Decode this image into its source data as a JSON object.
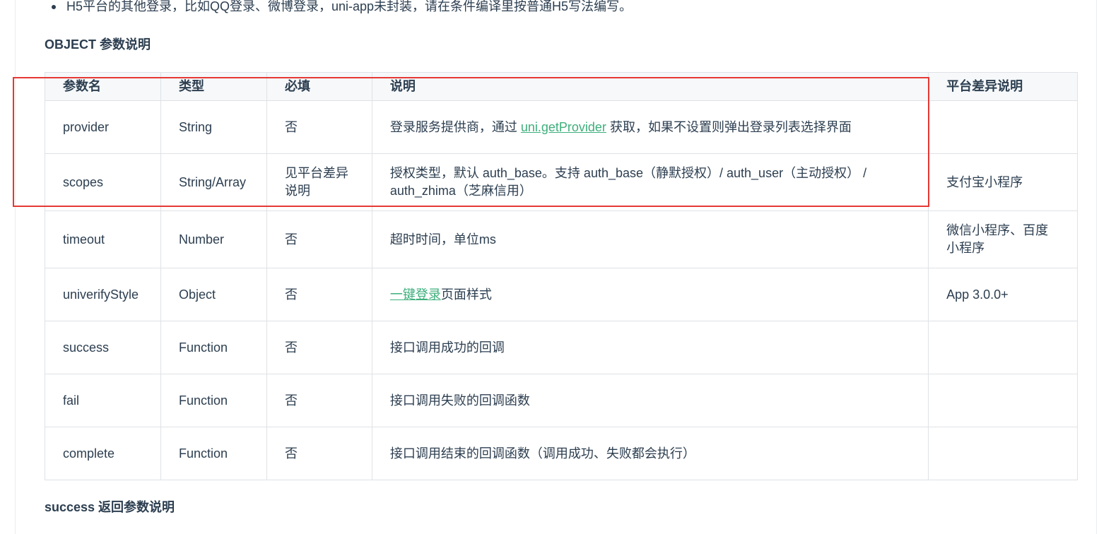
{
  "intro_bullet": "H5平台的其他登录，比如QQ登录、微博登录，uni-app未封装，请在条件编译里按普通H5写法编写。",
  "object_section_title": "OBJECT 参数说明",
  "success_section_title": "success 返回参数说明",
  "table": {
    "headers": [
      "参数名",
      "类型",
      "必填",
      "说明",
      "平台差异说明"
    ],
    "rows": [
      {
        "name": "provider",
        "type": "String",
        "required": "否",
        "desc_before": "登录服务提供商，通过 ",
        "desc_link": "uni.getProvider",
        "desc_after": " 获取，如果不设置则弹出登录列表选择界面",
        "platform": ""
      },
      {
        "name": "scopes",
        "type": "String/Array",
        "required": "见平台差异说明",
        "desc_before": "授权类型，默认 auth_base。支持 auth_base（静默授权）/ auth_user（主动授权） / auth_zhima（芝麻信用）",
        "desc_link": "",
        "desc_after": "",
        "platform": "支付宝小程序"
      },
      {
        "name": "timeout",
        "type": "Number",
        "required": "否",
        "desc_before": "超时时间，单位ms",
        "desc_link": "",
        "desc_after": "",
        "platform": "微信小程序、百度小程序"
      },
      {
        "name": "univerifyStyle",
        "type": "Object",
        "required": "否",
        "desc_before": "",
        "desc_link": "一键登录",
        "desc_after": "页面样式",
        "platform": "App 3.0.0+"
      },
      {
        "name": "success",
        "type": "Function",
        "required": "否",
        "desc_before": "接口调用成功的回调",
        "desc_link": "",
        "desc_after": "",
        "platform": ""
      },
      {
        "name": "fail",
        "type": "Function",
        "required": "否",
        "desc_before": "接口调用失败的回调函数",
        "desc_link": "",
        "desc_after": "",
        "platform": ""
      },
      {
        "name": "complete",
        "type": "Function",
        "required": "否",
        "desc_before": "接口调用结束的回调函数（调用成功、失败都会执行）",
        "desc_link": "",
        "desc_after": "",
        "platform": ""
      }
    ]
  },
  "colors": {
    "text": "#2c3e50",
    "link": "#3eaf7c",
    "border": "#dfe2e5",
    "header_bg": "#f6f8fa",
    "highlight": "#e53935"
  }
}
